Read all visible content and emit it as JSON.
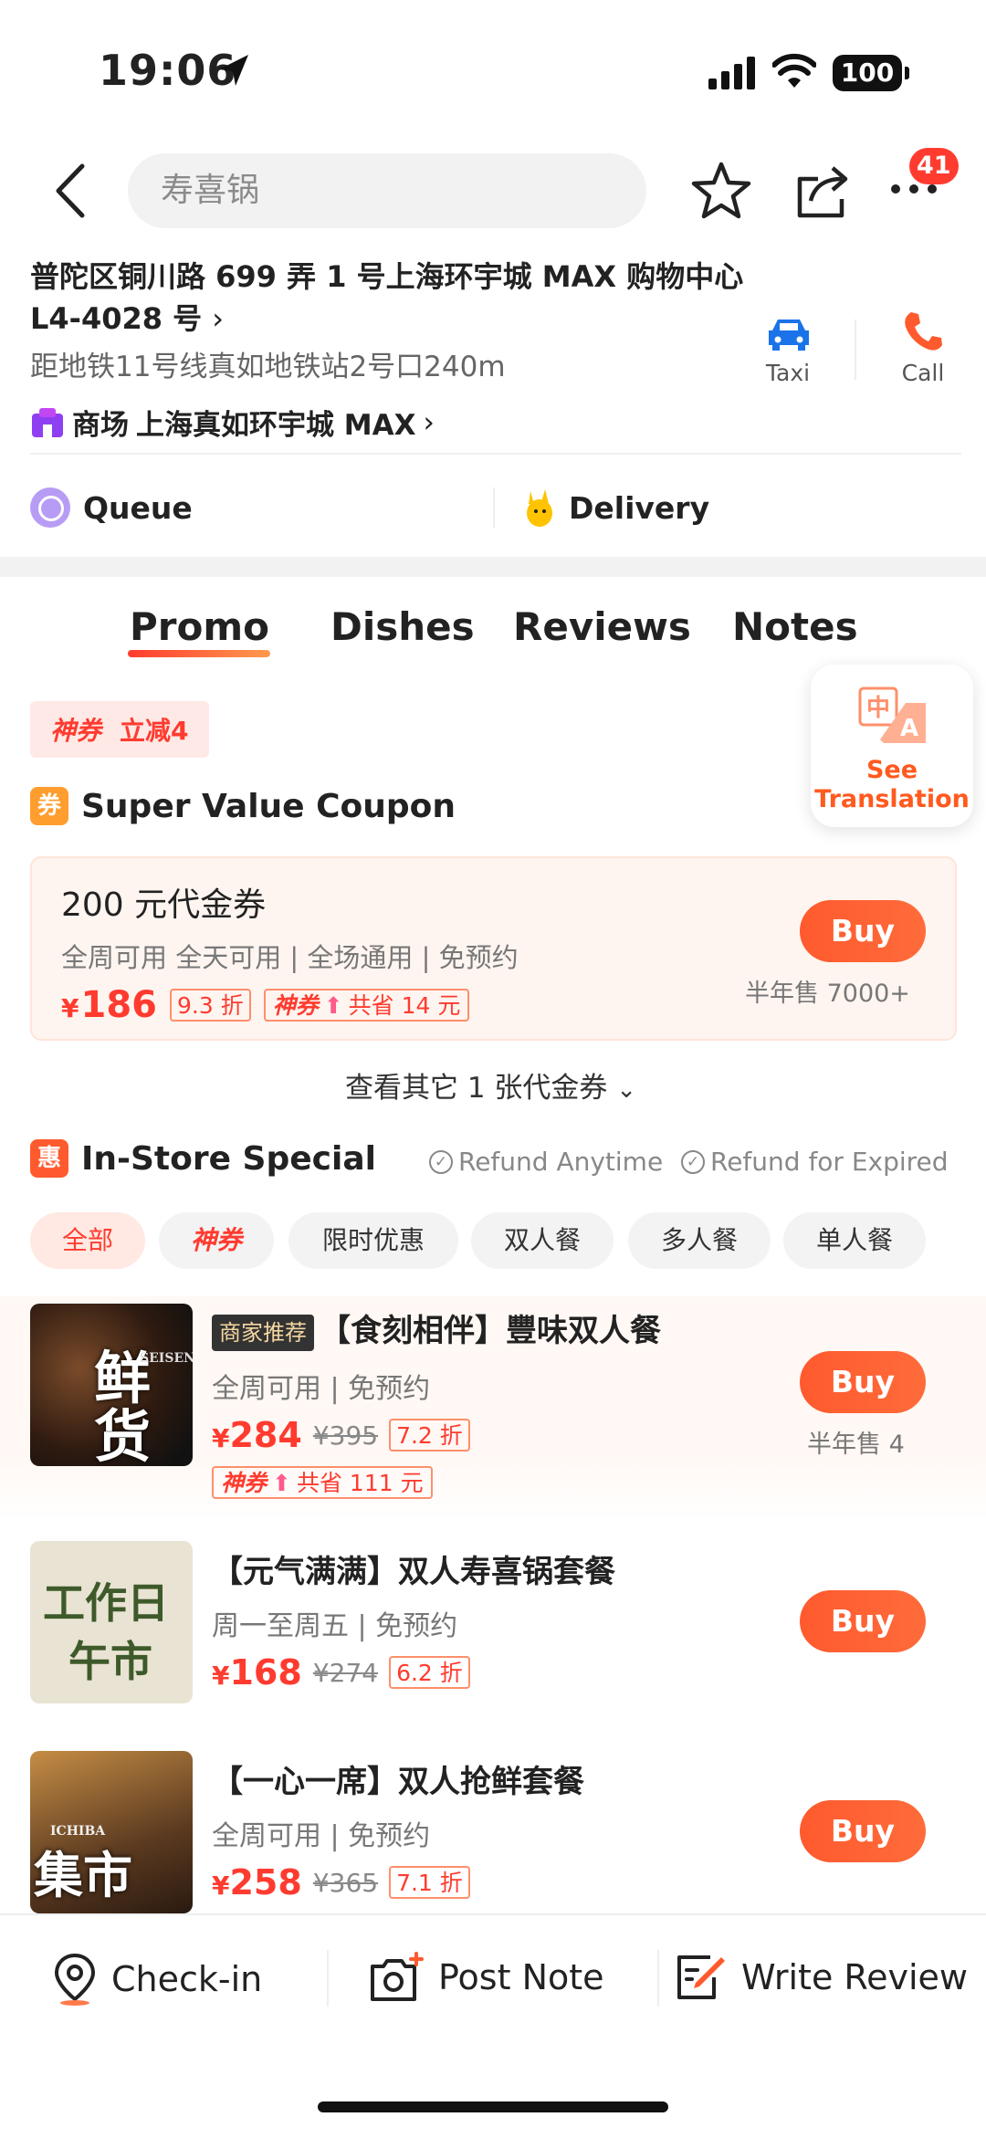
{
  "status_bar": {
    "time": "19:06",
    "battery": "100"
  },
  "header": {
    "search_placeholder": "寿喜锅",
    "notification_count": "41"
  },
  "address": {
    "line1": "普陀区铜川路 699 弄 1 号上海环宇城 MAX 购物中心",
    "line2": "L4-4028 号",
    "metro": "距地铁11号线真如地铁站2号口240m",
    "mall_prefix": "商场",
    "mall_name": "上海真如环宇城 MAX"
  },
  "actions": {
    "taxi": "Taxi",
    "call": "Call",
    "queue": "Queue",
    "delivery": "Delivery"
  },
  "tabs": [
    "Promo",
    "Dishes",
    "Reviews",
    "Notes"
  ],
  "translate": {
    "line1": "See",
    "line2": "Translation"
  },
  "god_tag": {
    "label": "神券",
    "text": "立减4"
  },
  "coupon_section": {
    "icon": "券",
    "title": "Super Value Coupon",
    "coupon": {
      "title": "200 元代金券",
      "sub": "全周可用 全天可用 | 全场通用 | 免预约",
      "yen": "¥",
      "price": "186",
      "discount": "9.3 折",
      "save_tag": "神券",
      "save_text": "共省 14 元",
      "buy": "Buy",
      "sold": "半年售 7000+"
    },
    "more": "查看其它 1 张代金券"
  },
  "instore": {
    "icon": "惠",
    "title": "In-Store Special",
    "refund1": "Refund Anytime",
    "refund2": "Refund for Expired",
    "chips": [
      "全部",
      "神券",
      "限时优惠",
      "双人餐",
      "多人餐",
      "单人餐"
    ],
    "deals": [
      {
        "badge": "商家推荐",
        "title": "【食刻相伴】豐味双人餐",
        "sub": "全周可用 | 免预约",
        "price": "284",
        "old": "¥395",
        "discount": "7.2 折",
        "save_tag": "神券",
        "save_text": "共省 111 元",
        "buy": "Buy",
        "sold": "半年售 4",
        "thumb_text": "鲜货",
        "thumb_small": "SEISEN"
      },
      {
        "title": "【元气满满】双人寿喜锅套餐",
        "sub": "周一至周五 | 免预约",
        "price": "168",
        "old": "¥274",
        "discount": "6.2 折",
        "buy": "Buy",
        "thumb_text1": "工作日",
        "thumb_text2": "午市"
      },
      {
        "title": "【一心一席】双人抢鲜套餐",
        "sub": "全周可用 | 免预约",
        "price": "258",
        "old": "¥365",
        "discount": "7.1 折",
        "buy": "Buy",
        "thumb_text": "集市",
        "thumb_small": "ICHIBA"
      }
    ],
    "yen": "¥"
  },
  "bottom_bar": {
    "checkin": "Check-in",
    "post_note": "Post Note",
    "write_review": "Write Review"
  },
  "colors": {
    "accent": "#FF5A2E",
    "price_red": "#FF3B2F",
    "badge_red": "#FF3B30"
  }
}
